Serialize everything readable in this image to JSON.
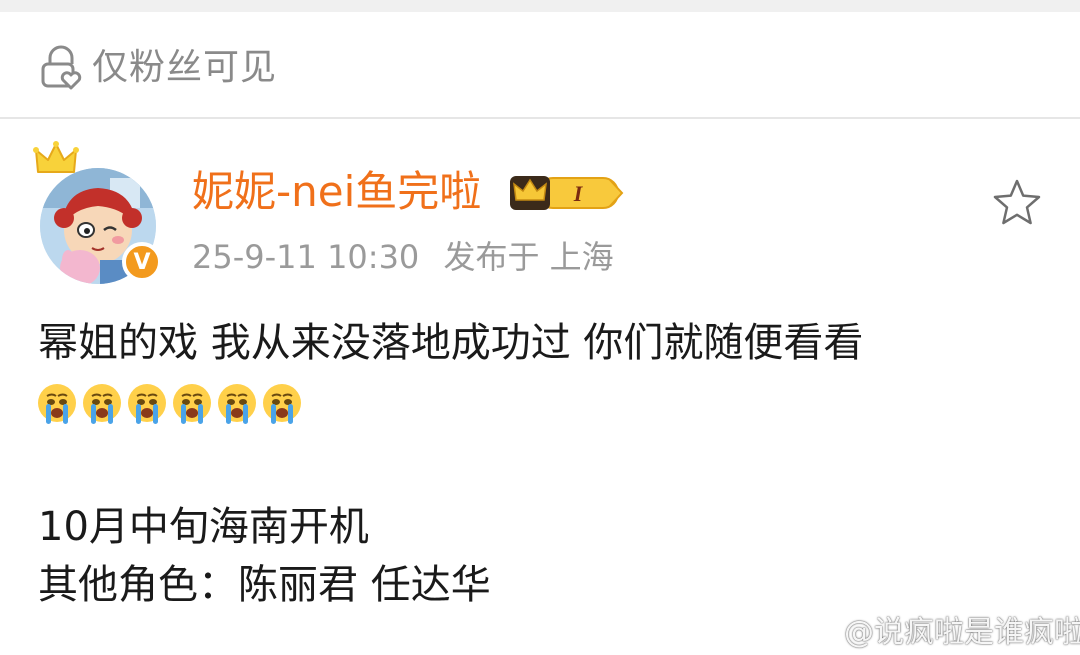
{
  "visibility": {
    "icon": "lock-heart-icon",
    "label": "仅粉丝可见"
  },
  "author": {
    "name": "妮妮-nei鱼完啦",
    "avatar": "cartoon-girl-avatar",
    "verified_badge": "V",
    "vip_badge_text": "I",
    "timestamp": "25-9-11 10:30",
    "posted_from": "发布于 上海"
  },
  "actions": {
    "favorite_icon": "star-outline-icon"
  },
  "post": {
    "line1": "幂姐的戏 我从来没落地成功过 你们就随便看看",
    "emoji": [
      "crying-face",
      "crying-face",
      "crying-face",
      "crying-face",
      "crying-face",
      "crying-face"
    ],
    "line2": "10月中旬海南开机",
    "line3": "其他角色：陈丽君 任达华"
  },
  "watermark": {
    "text": "@说疯啦是谁疯啦",
    "icon": "weibo-logo-icon"
  },
  "colors": {
    "username": "#f0701a",
    "secondary_text": "#9a9a9a",
    "body_text": "#1a1a1a",
    "verified": "#f39a1e"
  }
}
